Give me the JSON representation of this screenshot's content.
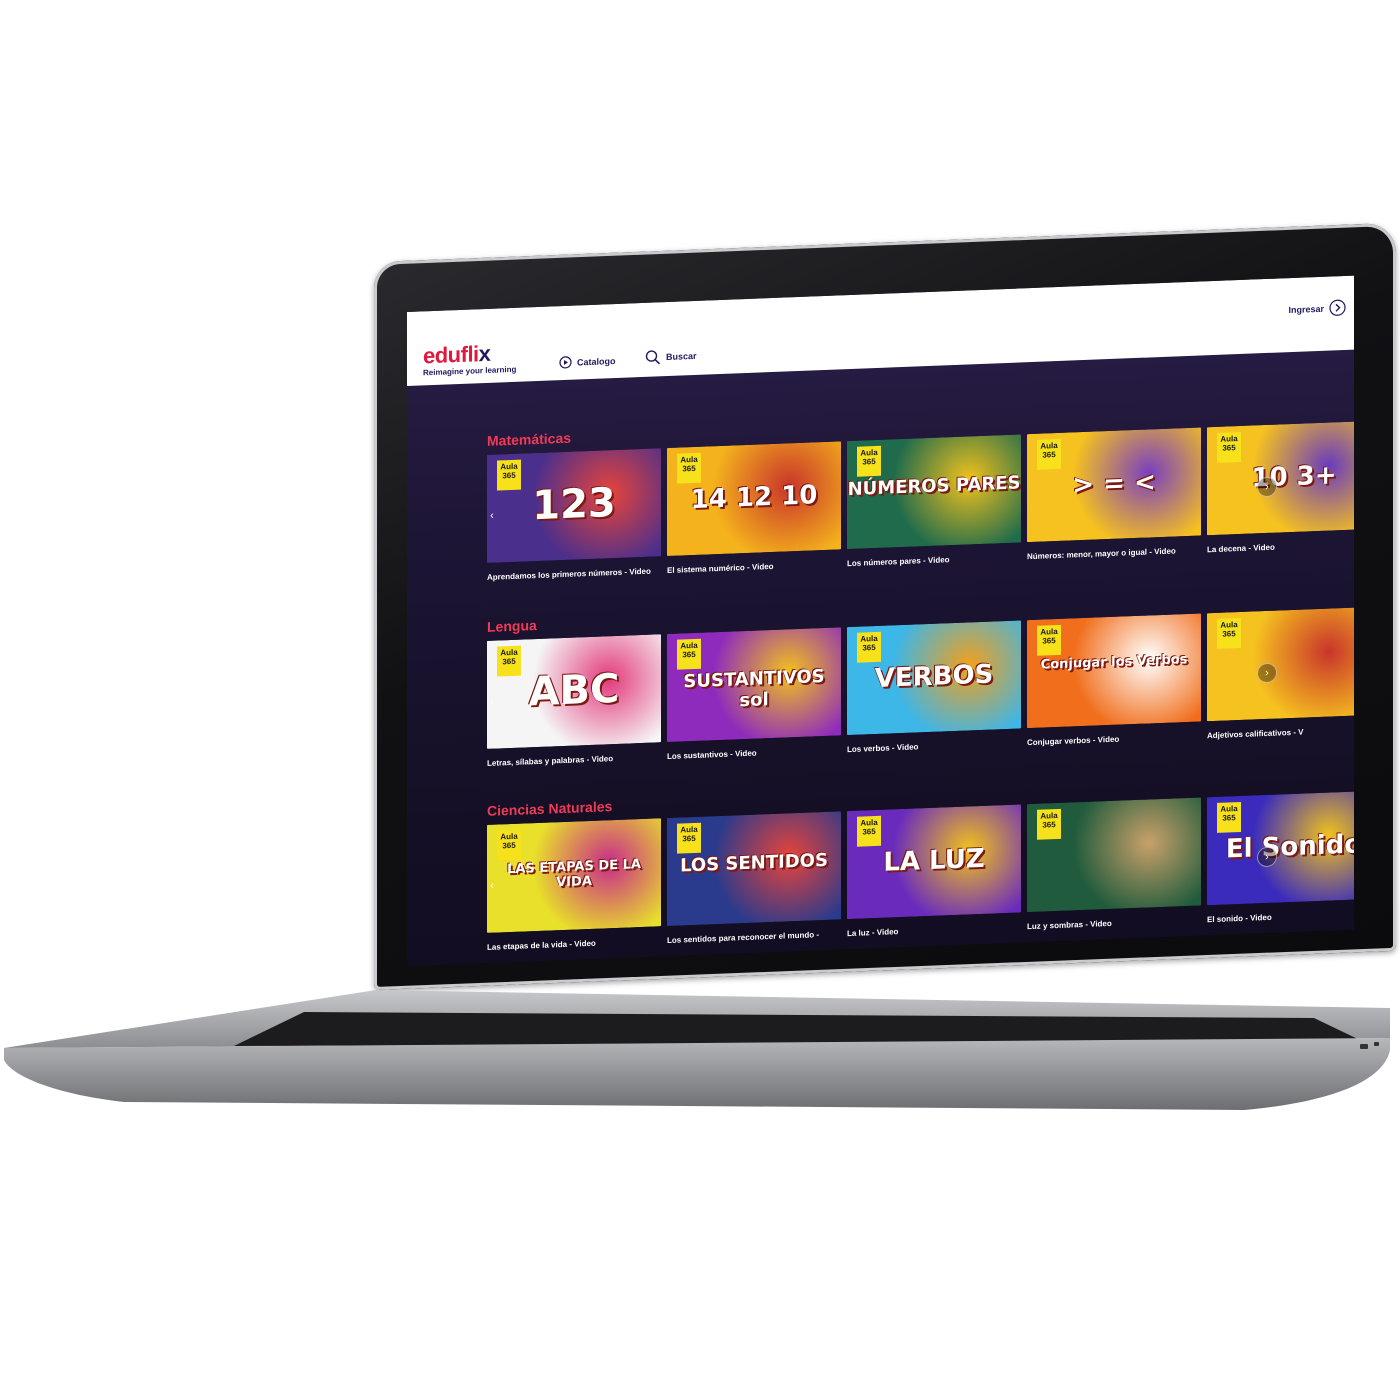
{
  "header": {
    "logo_word": "edufli",
    "logo_x": "x",
    "logo_tagline": "Reimagine your learning",
    "nav_catalogo": "Catalogo",
    "nav_buscar": "Buscar",
    "nav_ingresar": "Ingresar"
  },
  "badge": {
    "line1": "Aula",
    "line2": "365"
  },
  "sections": [
    {
      "title": "Matemáticas",
      "cards": [
        {
          "caption": "Aprendamos los primeros números - Video",
          "thumb_text": "123",
          "bg": "#4a2f8c",
          "accent": "#e8443a"
        },
        {
          "caption": "El sistema numérico - Video",
          "thumb_text": "14 12 10",
          "bg": "#f4b21c",
          "accent": "#c9352b"
        },
        {
          "caption": "Los números pares - Video",
          "thumb_text": "NÚMEROS PARES",
          "bg": "#1f6b4c",
          "accent": "#f2c21c"
        },
        {
          "caption": "Números: menor, mayor o igual - Video",
          "thumb_text": "> = <",
          "bg": "#f6c21f",
          "accent": "#7a3fc0"
        },
        {
          "caption": "La decena - Video",
          "thumb_text": "10 3+",
          "bg": "#f6c21f",
          "accent": "#6a3bbd"
        }
      ]
    },
    {
      "title": "Lengua",
      "cards": [
        {
          "caption": "Letras, sílabas y palabras - Video",
          "thumb_text": "ABC",
          "bg": "#f5f5f5",
          "accent": "#e23a7c"
        },
        {
          "caption": "Los sustantivos - Video",
          "thumb_text": "SUSTANTIVOS sol",
          "bg": "#8e2bbd",
          "accent": "#f2c21c"
        },
        {
          "caption": "Los verbos - Video",
          "thumb_text": "VERBOS",
          "bg": "#3db6e8",
          "accent": "#f2a01c"
        },
        {
          "caption": "Conjugar verbos - Video",
          "thumb_text": "Conjugar los Verbos",
          "bg": "#f06e1c",
          "accent": "#ffffff"
        },
        {
          "caption": "Adjetivos calificativos - V",
          "thumb_text": "",
          "bg": "#f6c21f",
          "accent": "#c9352b"
        }
      ]
    },
    {
      "title": "Ciencias Naturales",
      "cards": [
        {
          "caption": "Las etapas de la vida - Video",
          "thumb_text": "LAS ETAPAS DE LA VIDA",
          "bg": "#e8e02a",
          "accent": "#c92b8a"
        },
        {
          "caption": "Los sentidos para reconocer el mundo -",
          "thumb_text": "LOS SENTIDOS",
          "bg": "#2a3a8c",
          "accent": "#e8443a"
        },
        {
          "caption": "La luz - Video",
          "thumb_text": "LA LUZ",
          "bg": "#6a2bbd",
          "accent": "#f2c21c"
        },
        {
          "caption": "Luz y sombras - Video",
          "thumb_text": "",
          "bg": "#1f5b3c",
          "accent": "#c9a16a"
        },
        {
          "caption": "El sonido - Video",
          "thumb_text": "El Sonido",
          "bg": "#3a2bbd",
          "accent": "#f2c21c"
        }
      ]
    }
  ],
  "colors": {
    "brand_red": "#e0183e",
    "brand_navy": "#1d1b5e",
    "section_title": "#ef3b55",
    "badge": "#f6e11b"
  }
}
